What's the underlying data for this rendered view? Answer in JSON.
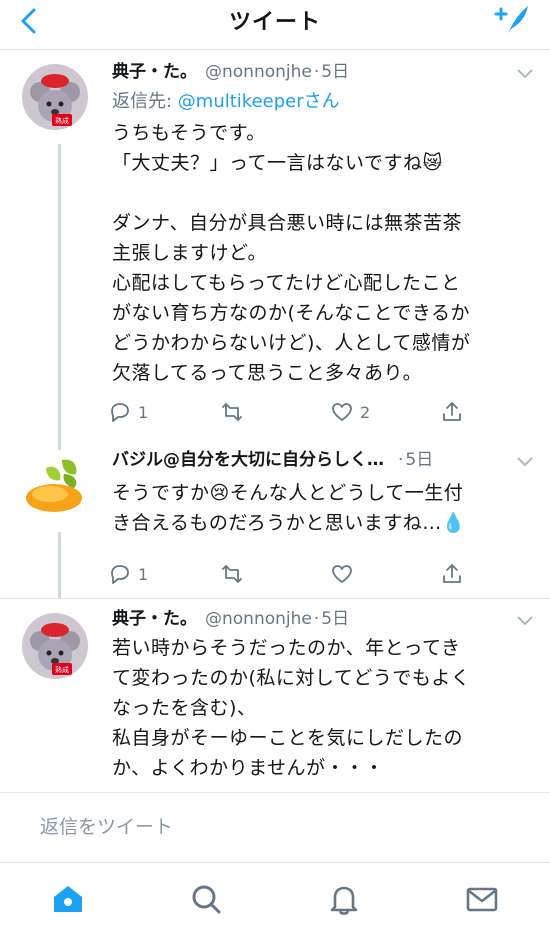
{
  "header": {
    "title": "ツイート",
    "back_icon": "chevron-left-icon",
    "compose_icon": "compose-tweet-icon",
    "accent": "#1da1f2"
  },
  "tweets": [
    {
      "name": "典子・た。",
      "handle": "@nonnonjhe",
      "dot": "·",
      "time": "5日",
      "reply_prefix": "返信先: ",
      "reply_mention": "@multikeeper",
      "reply_suffix": "さん",
      "lines": [
        "うちもそうです。",
        "「大丈夫？」って一言はないですね😿",
        "",
        "ダンナ、自分が具合悪い時には無茶苦茶",
        "主張しますけど。",
        "心配はしてもらってたけど心配したこと",
        "がない育ち方なのか(そんなことできるか",
        "どうかわからないけど)、人として感情が",
        "欠落してるって思うこと多々あり。"
      ],
      "reply_count": "1",
      "retweet_count": "",
      "like_count": "2"
    },
    {
      "name": "バジル@自分を大切に自分らしく…",
      "handle": "",
      "dot": "·",
      "time": "5日",
      "lines": [
        "そうですか😢そんな人とどうして一生付",
        "き合えるものだろうかと思いますね…💧"
      ],
      "reply_count": "1",
      "retweet_count": "",
      "like_count": ""
    },
    {
      "name": "典子・た。",
      "handle": "@nonnonjhe",
      "dot": "·",
      "time": "5日",
      "lines": [
        "若い時からそうだったのか、年とってき",
        "て変わったのか(私に対してどうでもよく",
        "なったを含む)、",
        "私自身がそーゆーことを気にしだしたの",
        "か、よくわかりませんが・・・"
      ]
    }
  ],
  "reply_bar": {
    "placeholder": "返信をツイート"
  },
  "tabbar": {
    "items": [
      "home-icon",
      "search-icon",
      "notifications-icon",
      "messages-icon"
    ]
  }
}
